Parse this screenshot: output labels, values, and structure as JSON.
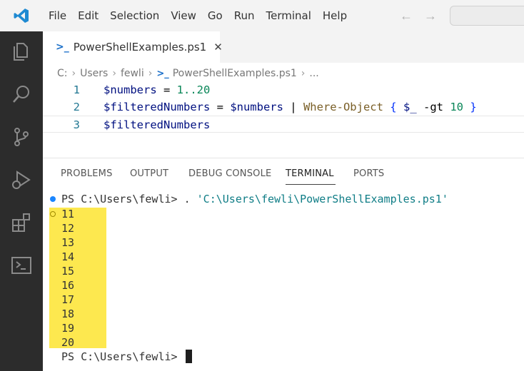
{
  "menu": [
    "File",
    "Edit",
    "Selection",
    "View",
    "Go",
    "Run",
    "Terminal",
    "Help"
  ],
  "nav": {
    "back": "←",
    "forward": "→"
  },
  "tab": {
    "label": "PowerShellExamples.ps1",
    "icon": "powershell-icon",
    "close": "✕"
  },
  "breadcrumb": [
    "C:",
    "Users",
    "fewli",
    "PowerShellExamples.ps1",
    "..."
  ],
  "editor": {
    "line_numbers": [
      "1",
      "2",
      "3"
    ],
    "lines": [
      [
        [
          "var",
          "$numbers"
        ],
        [
          "op",
          " = "
        ],
        [
          "num",
          "1..20"
        ]
      ],
      [
        [
          "var",
          "$filteredNumbers"
        ],
        [
          "op",
          " = "
        ],
        [
          "var",
          "$numbers"
        ],
        [
          "op",
          " | "
        ],
        [
          "cmd",
          "Where-Object"
        ],
        [
          "op",
          " "
        ],
        [
          "hl",
          "{"
        ],
        [
          "op",
          " "
        ],
        [
          "var",
          "$_"
        ],
        [
          "op",
          " -gt "
        ],
        [
          "num",
          "10"
        ],
        [
          "op",
          " "
        ],
        [
          "hl",
          "}"
        ]
      ],
      [
        [
          "var",
          "$filteredNumbers"
        ]
      ]
    ]
  },
  "panel_tabs": [
    "PROBLEMS",
    "OUTPUT",
    "DEBUG CONSOLE",
    "TERMINAL",
    "PORTS"
  ],
  "terminal": {
    "prompt_prefix": "PS C:\\Users\\fewli> ",
    "command_dot": ". ",
    "command_path": "'C:\\Users\\fewli\\PowerShellExamples.ps1'",
    "output": [
      "11",
      "12",
      "13",
      "14",
      "15",
      "16",
      "17",
      "18",
      "19",
      "20"
    ],
    "final_prompt": "PS C:\\Users\\fewli> "
  },
  "colors": {
    "activity_bar": "#2c2c2c",
    "highlight": "#fde84f",
    "accent": "#1a85ff"
  }
}
